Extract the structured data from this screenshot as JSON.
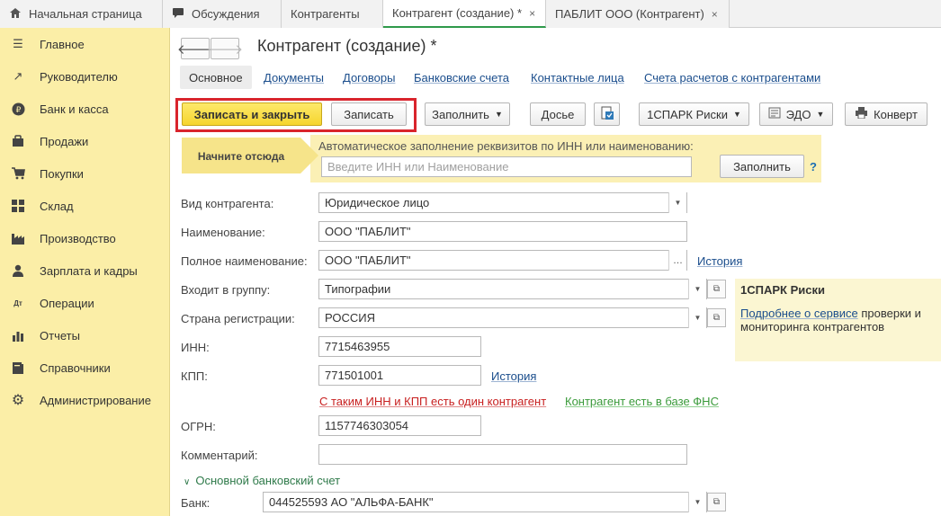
{
  "tabs": [
    {
      "label": "Начальная страница",
      "icon": "home-icon"
    },
    {
      "label": "Обсуждения",
      "icon": "chat-icon"
    },
    {
      "label": "Контрагенты"
    },
    {
      "label": "Контрагент (создание) *",
      "active": true,
      "close": "×"
    },
    {
      "label": "ПАБЛИТ ООО (Контрагент)",
      "close": "×"
    }
  ],
  "sidebar": {
    "items": [
      {
        "label": "Главное",
        "icon": "menu-icon",
        "glyph": "☰"
      },
      {
        "label": "Руководителю",
        "icon": "trend-icon",
        "glyph": "↗"
      },
      {
        "label": "Банк и касса",
        "icon": "ruble-coin-icon",
        "glyph": "₽"
      },
      {
        "label": "Продажи",
        "icon": "bag-icon",
        "glyph": "▣"
      },
      {
        "label": "Покупки",
        "icon": "cart-icon",
        "glyph": "⛟"
      },
      {
        "label": "Склад",
        "icon": "warehouse-grid-icon",
        "glyph": "▦"
      },
      {
        "label": "Производство",
        "icon": "factory-icon",
        "glyph": "▙"
      },
      {
        "label": "Зарплата и кадры",
        "icon": "person-icon",
        "glyph": "●"
      },
      {
        "label": "Операции",
        "icon": "debit-credit-icon",
        "glyph": "Дт"
      },
      {
        "label": "Отчеты",
        "icon": "bar-report-icon",
        "glyph": "▮"
      },
      {
        "label": "Справочники",
        "icon": "books-icon",
        "glyph": "▤"
      },
      {
        "label": "Администрирование",
        "icon": "gear-icon",
        "glyph": "⚙"
      }
    ]
  },
  "header": {
    "title": "Контрагент (создание) *",
    "back": "🡐",
    "forward": "🡒"
  },
  "subtabs": [
    "Основное",
    "Документы",
    "Договоры",
    "Банковские счета",
    "Контактные лица",
    "Счета расчетов с контрагентами"
  ],
  "toolbar": {
    "save_close": "Записать и закрыть",
    "save": "Записать",
    "fill": "Заполнить",
    "dossier": "Досье",
    "spark": "1СПАРК Риски",
    "edo": "ЭДО",
    "envelope": "Конверт"
  },
  "autofill": {
    "start_here": "Начните отсюда",
    "hint": "Автоматическое заполнение реквизитов по ИНН или наименованию:",
    "placeholder": "Введите ИНН или Наименование",
    "button": "Заполнить",
    "help": "?"
  },
  "form": {
    "kind_label": "Вид контрагента:",
    "kind_value": "Юридическое лицо",
    "name_label": "Наименование:",
    "name_value": "ООО \"ПАБЛИТ\"",
    "fullname_label": "Полное наименование:",
    "fullname_value": "ООО \"ПАБЛИТ\"",
    "history": "История",
    "group_label": "Входит в группу:",
    "group_value": "Типографии",
    "country_label": "Страна регистрации:",
    "country_value": "РОССИЯ",
    "inn_label": "ИНН:",
    "inn_value": "7715463955",
    "kpp_label": "КПП:",
    "kpp_value": "771501001",
    "warning": "С таким ИНН и КПП есть один контрагент",
    "fns_ok": "Контрагент есть в базе ФНС",
    "ogrn_label": "ОГРН:",
    "ogrn_value": "1157746303054",
    "comment_label": "Комментарий:",
    "comment_value": "",
    "bank_group": "Основной банковский счет",
    "bank_label": "Банк:",
    "bank_value": "044525593 АО \"АЛЬФА-БАНК\""
  },
  "spark_panel": {
    "title": "1СПАРК Риски",
    "link": "Подробнее о сервисе",
    "text_after_link": " проверки и мониторинга контрагентов"
  },
  "colors": {
    "sidebar_bg": "#fbeea7",
    "primary_button": "#f6d52e",
    "highlight_border": "#d9242c",
    "link": "#1a4d8c",
    "warning": "#c82020",
    "ok": "#3a9a3a"
  }
}
